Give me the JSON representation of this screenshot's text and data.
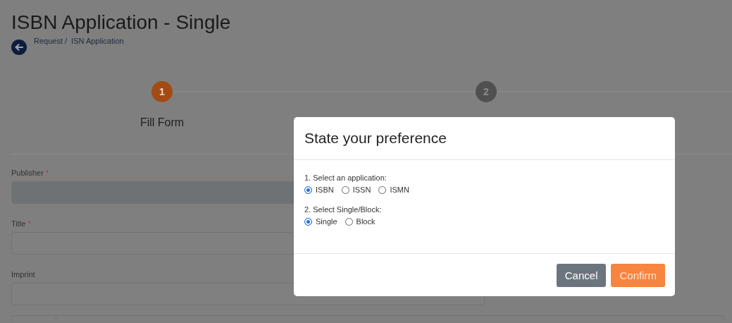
{
  "page": {
    "title": "ISBN Application - Single",
    "breadcrumb": [
      {
        "label": "Request /"
      },
      {
        "label": "ISN Application"
      }
    ]
  },
  "steps": [
    {
      "number": "1",
      "label": "Fill Form",
      "active": true
    },
    {
      "number": "2",
      "active": false
    }
  ],
  "fields": [
    {
      "label": "Publisher",
      "required_mark": "*",
      "disabled": true
    },
    {
      "label": "Title",
      "required_mark": "*",
      "disabled": false
    },
    {
      "label": "Imprint",
      "disabled": false
    }
  ],
  "dialog": {
    "title": "State your preference",
    "groups": [
      {
        "label": "1. Select an application:",
        "options": [
          {
            "label": "ISBN",
            "selected": true
          },
          {
            "label": "ISSN",
            "selected": false
          },
          {
            "label": "ISMN",
            "selected": false
          }
        ]
      },
      {
        "label": "2. Select Single/Block:",
        "options": [
          {
            "label": "Single",
            "selected": true
          },
          {
            "label": "Block",
            "selected": false
          }
        ]
      }
    ],
    "buttons": [
      {
        "label": "Cancel",
        "kind": "secondary"
      },
      {
        "label": "Confirm",
        "kind": "primary"
      }
    ]
  }
}
